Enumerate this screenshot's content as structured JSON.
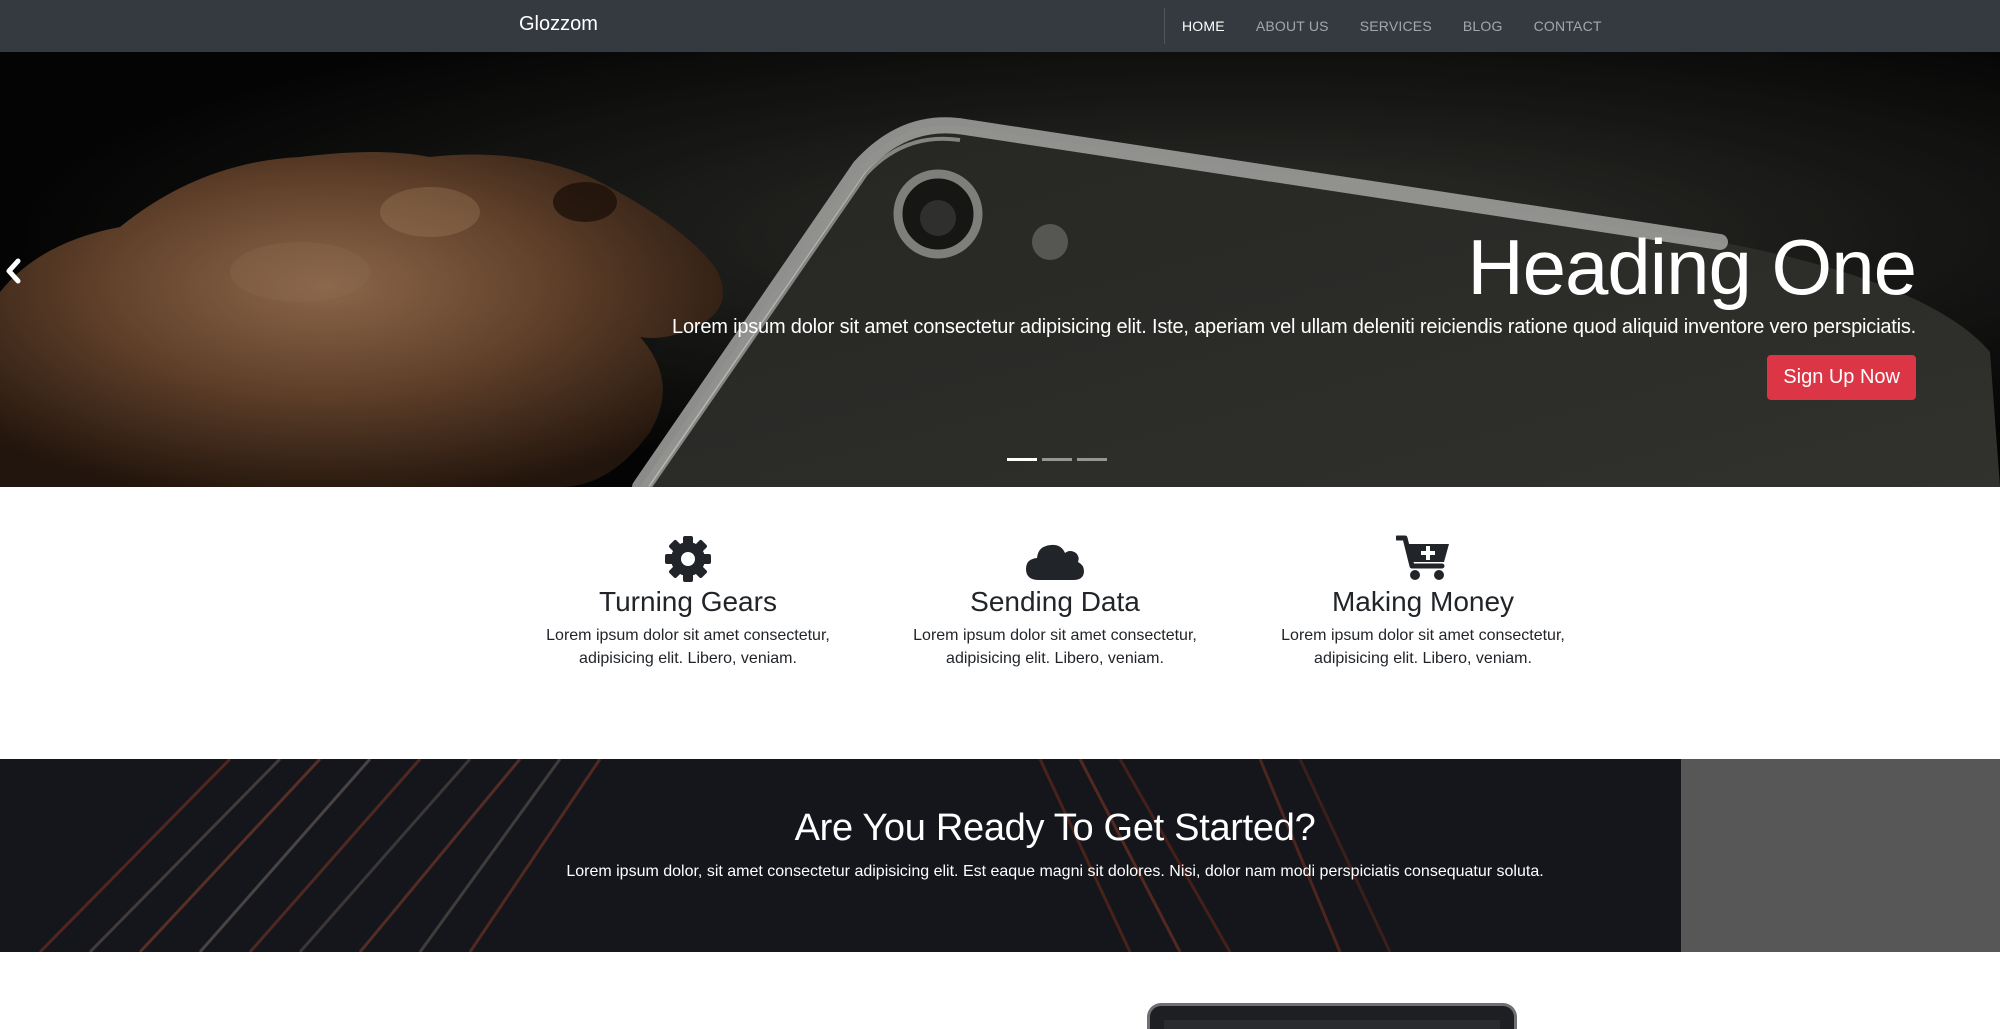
{
  "navbar": {
    "brand": "Glozzom",
    "items": [
      {
        "label": "HOME",
        "active": true
      },
      {
        "label": "ABOUT US",
        "active": false
      },
      {
        "label": "SERVICES",
        "active": false
      },
      {
        "label": "BLOG",
        "active": false
      },
      {
        "label": "CONTACT",
        "active": false
      }
    ]
  },
  "hero": {
    "title": "Heading One",
    "text": "Lorem ipsum dolor sit amet consectetur adipisicing elit. Iste, aperiam vel ullam deleniti reiciendis ratione quod aliquid inventore vero perspiciatis.",
    "button": "Sign Up Now",
    "prev_icon": "chevron-left-icon",
    "slides": 3,
    "active_slide": 1
  },
  "features": [
    {
      "icon": "gear-icon",
      "title": "Turning Gears",
      "line1": "Lorem ipsum dolor sit amet consectetur,",
      "line2": "adipisicing elit. Libero, veniam."
    },
    {
      "icon": "cloud-icon",
      "title": "Sending Data",
      "line1": "Lorem ipsum dolor sit amet consectetur,",
      "line2": "adipisicing elit. Libero, veniam."
    },
    {
      "icon": "cart-plus-icon",
      "title": "Making Money",
      "line1": "Lorem ipsum dolor sit amet consectetur,",
      "line2": "adipisicing elit. Libero, veniam."
    }
  ],
  "cta": {
    "title": "Are You Ready To Get Started?",
    "text": "Lorem ipsum dolor, sit amet consectetur adipisicing elit. Est eaque magni sit dolores. Nisi, dolor nam modi perspiciatis consequatur soluta."
  },
  "colors": {
    "navbar": "#343a40",
    "accent": "#dc3545",
    "text": "#212529"
  }
}
